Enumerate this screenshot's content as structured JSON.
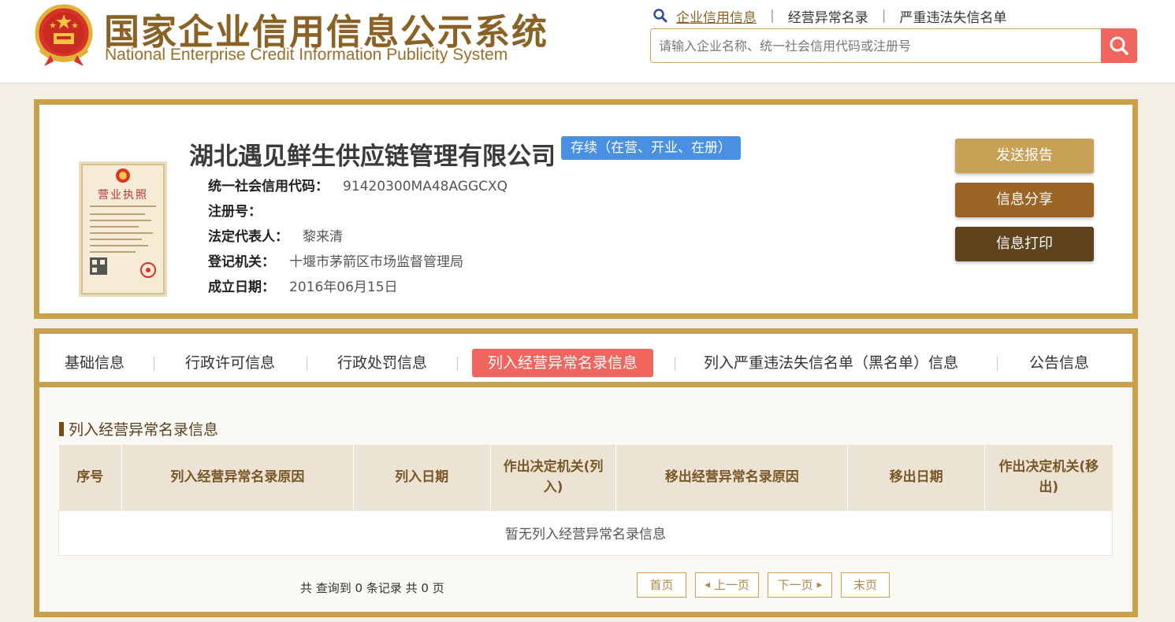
{
  "header": {
    "title_cn": "国家企业信用信息公示系统",
    "title_en": "National Enterprise Credit Information Publicity System",
    "links": [
      "企业信用信息",
      "经营异常名录",
      "严重违法失信名单"
    ],
    "search_placeholder": "请输入企业名称、统一社会信用代码或注册号"
  },
  "company": {
    "name": "湖北遇见鲜生供应链管理有限公司",
    "status": "存续（在营、开业、在册）",
    "fields": [
      {
        "label": "统一社会信用代码：",
        "value": "91420300MA48AGGCXQ"
      },
      {
        "label": "注册号：",
        "value": ""
      },
      {
        "label": "法定代表人：",
        "value": "黎来清"
      },
      {
        "label": "登记机关：",
        "value": "十堰市茅箭区市场监督管理局"
      },
      {
        "label": "成立日期：",
        "value": "2016年06月15日"
      }
    ],
    "license_title": "营业执照"
  },
  "actions": {
    "send_report": "发送报告",
    "share": "信息分享",
    "print": "信息打印"
  },
  "tabs": [
    "基础信息",
    "行政许可信息",
    "行政处罚信息",
    "列入经营异常名录信息",
    "列入严重违法失信名单（黑名单）信息",
    "公告信息"
  ],
  "section": {
    "title": "列入经营异常名录信息",
    "columns": [
      "序号",
      "列入经营异常名录原因",
      "列入日期",
      "作出决定机关(列入)",
      "移出经营异常名录原因",
      "移出日期",
      "作出决定机关(移出)"
    ],
    "empty_text": "暂无列入经营异常名录信息"
  },
  "pagination": {
    "summary": "共 查询到 0 条记录 共 0 页",
    "first": "首页",
    "prev": "上一页",
    "next": "下一页",
    "last": "末页"
  },
  "colors": {
    "accent": "#c9a14d",
    "active_tab": "#f0665f",
    "status": "#4a90e2",
    "brown_dark": "#5f431c"
  }
}
